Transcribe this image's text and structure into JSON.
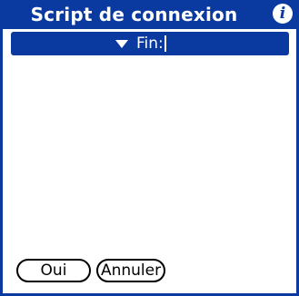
{
  "dialog": {
    "title": "Script de connexion",
    "info_icon": "info-icon"
  },
  "script_list": {
    "items": [
      {
        "command": "Fin:",
        "selected": true
      }
    ]
  },
  "buttons": {
    "ok_label": "Oui",
    "cancel_label": "Annuler"
  },
  "colors": {
    "accent": "#0a3aa0",
    "background": "#ffffff",
    "text": "#000000"
  }
}
